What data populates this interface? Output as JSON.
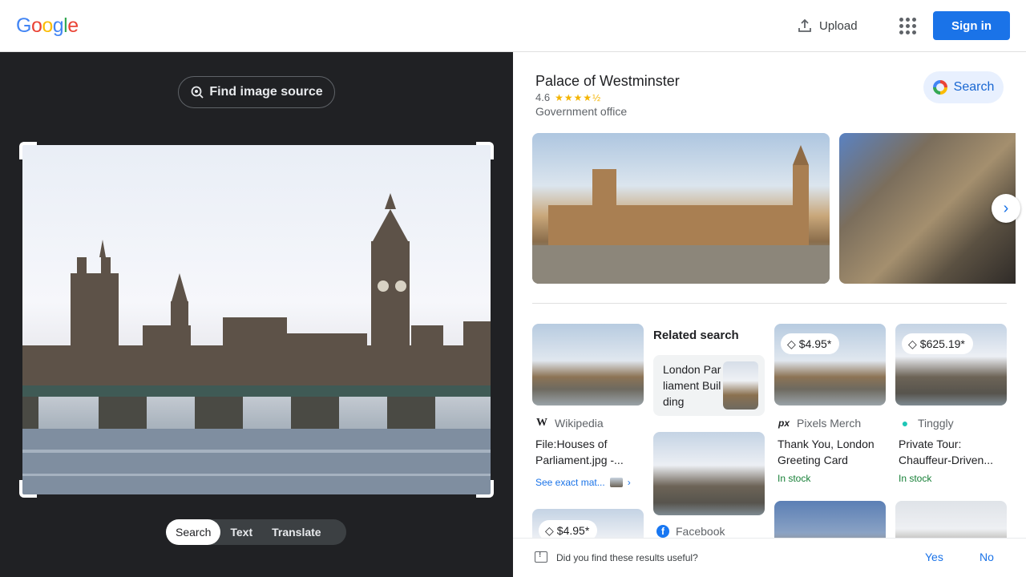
{
  "brand": {
    "logo_letters": [
      "G",
      "o",
      "o",
      "g",
      "l",
      "e"
    ],
    "logo_colors": [
      "#4285f4",
      "#ea4335",
      "#fbbc05",
      "#4285f4",
      "#34a853",
      "#ea4335"
    ]
  },
  "header": {
    "upload_label": "Upload",
    "upload_icon": "upload-icon",
    "apps_icon": "apps-grid-icon",
    "signin_label": "Sign in",
    "accent_color": "#1a73e8"
  },
  "left_panel": {
    "find_source_label": "Find image source",
    "find_source_icon": "lens-search-icon",
    "tabs": [
      {
        "label": "Search",
        "active": true
      },
      {
        "label": "Text",
        "active": false
      },
      {
        "label": "Translate",
        "active": false
      }
    ]
  },
  "knowledge_panel": {
    "title": "Palace of Westminster",
    "rating": "4.6",
    "stars": "★★★★½",
    "type": "Government office",
    "search_label": "Search",
    "next_icon": "chevron-right-icon"
  },
  "results": {
    "wikipedia": {
      "source": "Wikipedia",
      "source_icon": "W",
      "title": "File:Houses of Parliament.jpg -...",
      "see_exact": "See exact mat..."
    },
    "related": {
      "heading": "Related search",
      "chip_label": "London Parliament Building"
    },
    "facebook": {
      "source": "Facebook"
    },
    "pixels": {
      "price": "$4.95*",
      "source": "Pixels Merch",
      "source_icon": "px",
      "title": "Thank You, London Greeting Card",
      "stock": "In stock"
    },
    "tinggly": {
      "price": "$625.19*",
      "source": "Tinggly",
      "title": "Private Tour: Chauffeur-Driven...",
      "stock": "In stock"
    },
    "bottom_price": "$4.95*"
  },
  "feedback": {
    "question": "Did you find these results useful?",
    "yes": "Yes",
    "no": "No"
  }
}
